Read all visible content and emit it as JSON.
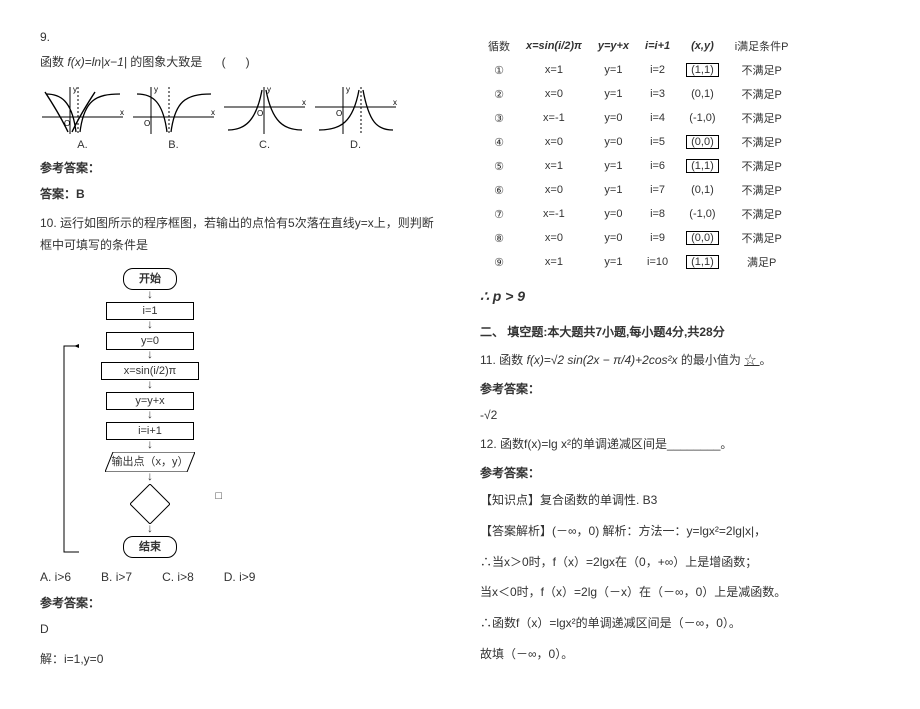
{
  "left": {
    "q9_num": "9.",
    "q9_text_a": "函数",
    "q9_formula": "f(x)=ln|x−1|",
    "q9_text_b": "的图象大致是",
    "q9_paren_l": "(",
    "q9_paren_r": ")",
    "graph_labels": [
      "A.",
      "B.",
      "C.",
      "D."
    ],
    "ref_ans": "参考答案：",
    "q9_answer": "答案：B",
    "q10_text": "10. 运行如图所示的程序框图，若输出的点恰有5次落在直线y=x上，则判断框中可填写的条件是",
    "flow": {
      "start": "开始",
      "s1": "i=1",
      "s2": "y=0",
      "s3": "x=sin(i/2)π",
      "s4": "y=y+x",
      "s5": "i=i+1",
      "out": "输出点（x，y）",
      "cond_blank": "□",
      "end": "结束"
    },
    "options": {
      "A": "A.  i>6",
      "B": "B.  i>7",
      "C": "C.  i>8",
      "D": "D.  i>9"
    },
    "q10_ans_label": "参考答案：",
    "q10_ans": "D",
    "q10_sol_start": "解：i=1,y=0"
  },
  "right": {
    "header": {
      "c0": "循数",
      "c1": "x=sin(i/2)π",
      "c2": "y=y+x",
      "c3": "i=i+1",
      "c4": "(x,y)",
      "c5": "i满足条件P"
    },
    "rows": [
      {
        "n": "①",
        "x": "x=1",
        "y": "y=1",
        "i": "i=2",
        "pt": "(1,1)",
        "box": true,
        "p": "不满足P"
      },
      {
        "n": "②",
        "x": "x=0",
        "y": "y=1",
        "i": "i=3",
        "pt": "(0,1)",
        "box": false,
        "p": "不满足P"
      },
      {
        "n": "③",
        "x": "x=-1",
        "y": "y=0",
        "i": "i=4",
        "pt": "(-1,0)",
        "box": false,
        "p": "不满足P"
      },
      {
        "n": "④",
        "x": "x=0",
        "y": "y=0",
        "i": "i=5",
        "pt": "(0,0)",
        "box": true,
        "p": "不满足P"
      },
      {
        "n": "⑤",
        "x": "x=1",
        "y": "y=1",
        "i": "i=6",
        "pt": "(1,1)",
        "box": true,
        "p": "不满足P"
      },
      {
        "n": "⑥",
        "x": "x=0",
        "y": "y=1",
        "i": "i=7",
        "pt": "(0,1)",
        "box": false,
        "p": "不满足P"
      },
      {
        "n": "⑦",
        "x": "x=-1",
        "y": "y=0",
        "i": "i=8",
        "pt": "(-1,0)",
        "box": false,
        "p": "不满足P"
      },
      {
        "n": "⑧",
        "x": "x=0",
        "y": "y=0",
        "i": "i=9",
        "pt": "(0,0)",
        "box": true,
        "p": "不满足P"
      },
      {
        "n": "⑨",
        "x": "x=1",
        "y": "y=1",
        "i": "i=10",
        "pt": "(1,1)",
        "box": true,
        "p": "满足P"
      }
    ],
    "conclusion": "∴ p > 9",
    "section2": "二、 填空题:本大题共7小题,每小题4分,共28分",
    "q11_a": "11. 函数",
    "q11_formula": "f(x)=√2 sin(2x − π/4)+2cos²x",
    "q11_b": "的最小值为",
    "q11_blank": "   ☆   ",
    "q11_dot": "。",
    "q11_ans_label": "参考答案：",
    "q11_ans": "-√2",
    "q12_text": "12. 函数f(x)=lg x²的单调递减区间是________。",
    "q12_ans_label": "参考答案：",
    "q12_k": "【知识点】复合函数的单调性.    B3",
    "q12_sol1": "【答案解析】(－∞，0)    解析：方法一：y=lgx²=2lg|x|，",
    "q12_sol2": "∴当x＞0时，f（x）=2lgx在（0，+∞）上是增函数；",
    "q12_sol3": "当x＜0时，f（x）=2lg（－x）在（－∞，0）上是减函数。",
    "q12_sol4": "∴函数f（x）=lgx²的单调递减区间是（－∞，0）。",
    "q12_sol5": "故填（－∞，0）。"
  }
}
